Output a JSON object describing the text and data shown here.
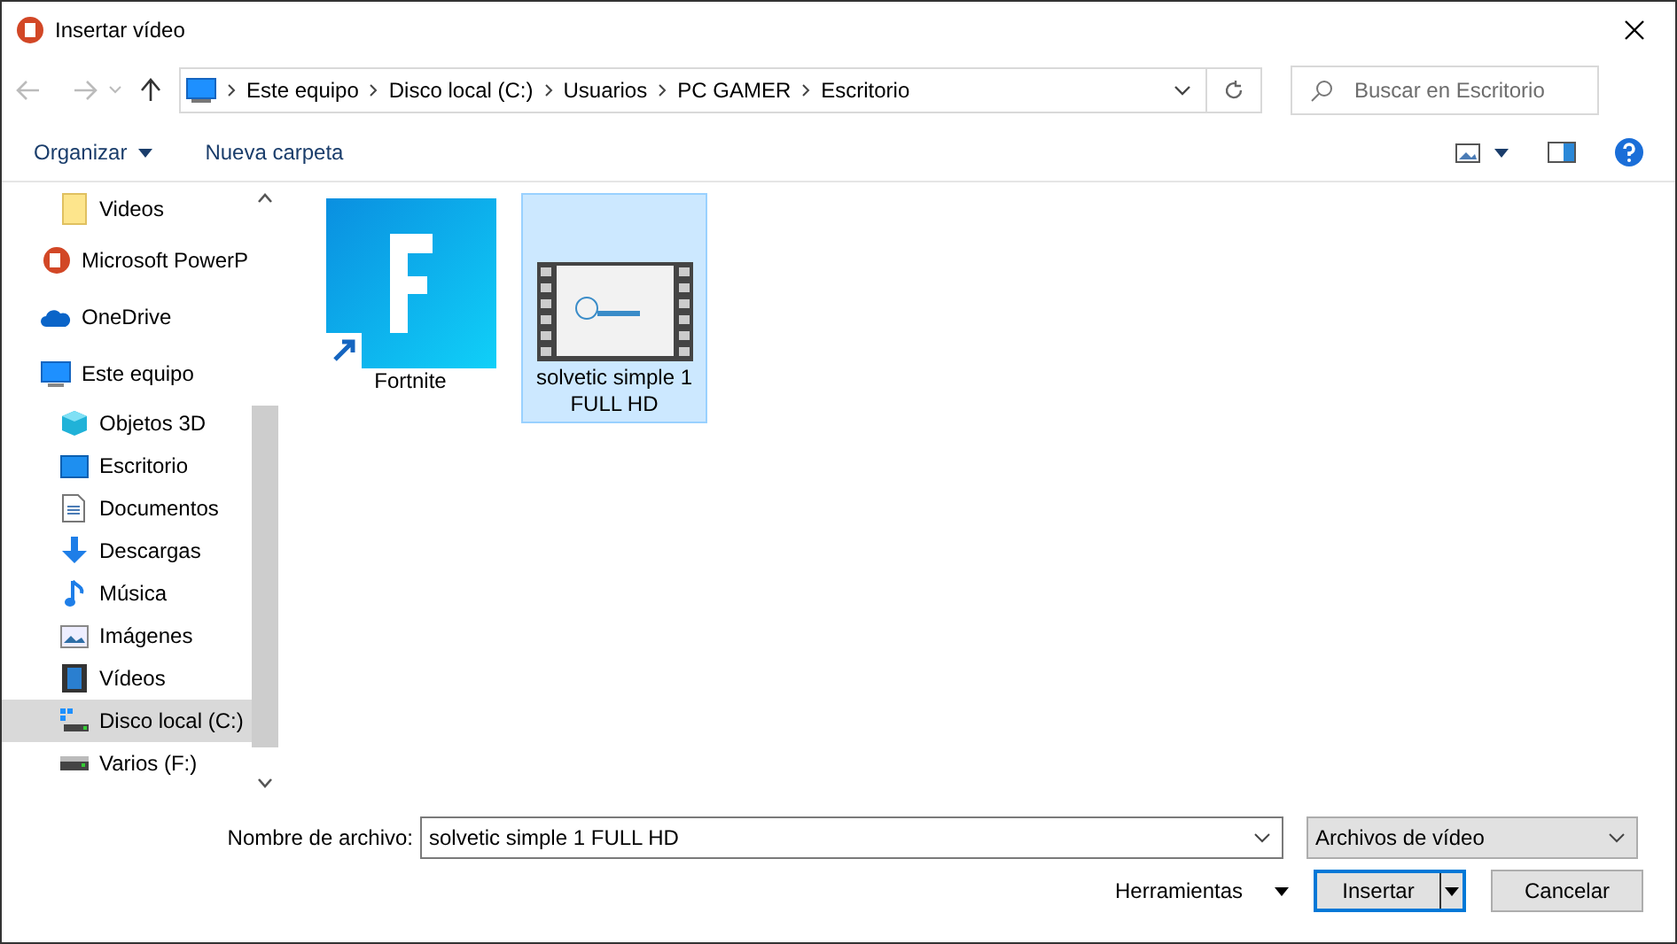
{
  "window": {
    "title": "Insertar vídeo"
  },
  "address_bar": {
    "segments": [
      "Este equipo",
      "Disco local (C:)",
      "Usuarios",
      "PC GAMER",
      "Escritorio"
    ]
  },
  "search": {
    "placeholder": "Buscar en Escritorio"
  },
  "toolbar": {
    "organize": "Organizar",
    "new_folder": "Nueva carpeta"
  },
  "quick_access_items": [
    {
      "label": "Videos",
      "kind": "folder",
      "selected": false
    }
  ],
  "sidebar": {
    "items": [
      {
        "label": "Microsoft PowerP",
        "kind": "powerpoint",
        "selected": false
      },
      {
        "label": "OneDrive",
        "kind": "cloud",
        "selected": false
      },
      {
        "label": "Este equipo",
        "kind": "pc",
        "selected": false,
        "children": [
          {
            "label": "Objetos 3D",
            "kind": "cube",
            "selected": false
          },
          {
            "label": "Escritorio",
            "kind": "desktop",
            "selected": false
          },
          {
            "label": "Documentos",
            "kind": "document",
            "selected": false
          },
          {
            "label": "Descargas",
            "kind": "download",
            "selected": false
          },
          {
            "label": "Música",
            "kind": "music",
            "selected": false
          },
          {
            "label": "Imágenes",
            "kind": "image",
            "selected": false
          },
          {
            "label": "Vídeos",
            "kind": "film",
            "selected": false
          },
          {
            "label": "Disco local (C:)",
            "kind": "systemdrive",
            "selected": true
          },
          {
            "label": "Varios (F:)",
            "kind": "drive",
            "selected": false
          }
        ]
      }
    ]
  },
  "files": [
    {
      "label": "Fortnite",
      "kind": "shortcut",
      "selected": false
    },
    {
      "label": "solvetic simple 1 FULL HD",
      "kind": "video",
      "selected": true
    }
  ],
  "file_name": {
    "label": "Nombre de archivo:",
    "value": "solvetic simple 1 FULL HD"
  },
  "file_type": {
    "value": "Archivos de vídeo"
  },
  "buttons": {
    "tools": "Herramientas",
    "insert": "Insertar",
    "cancel": "Cancelar"
  }
}
